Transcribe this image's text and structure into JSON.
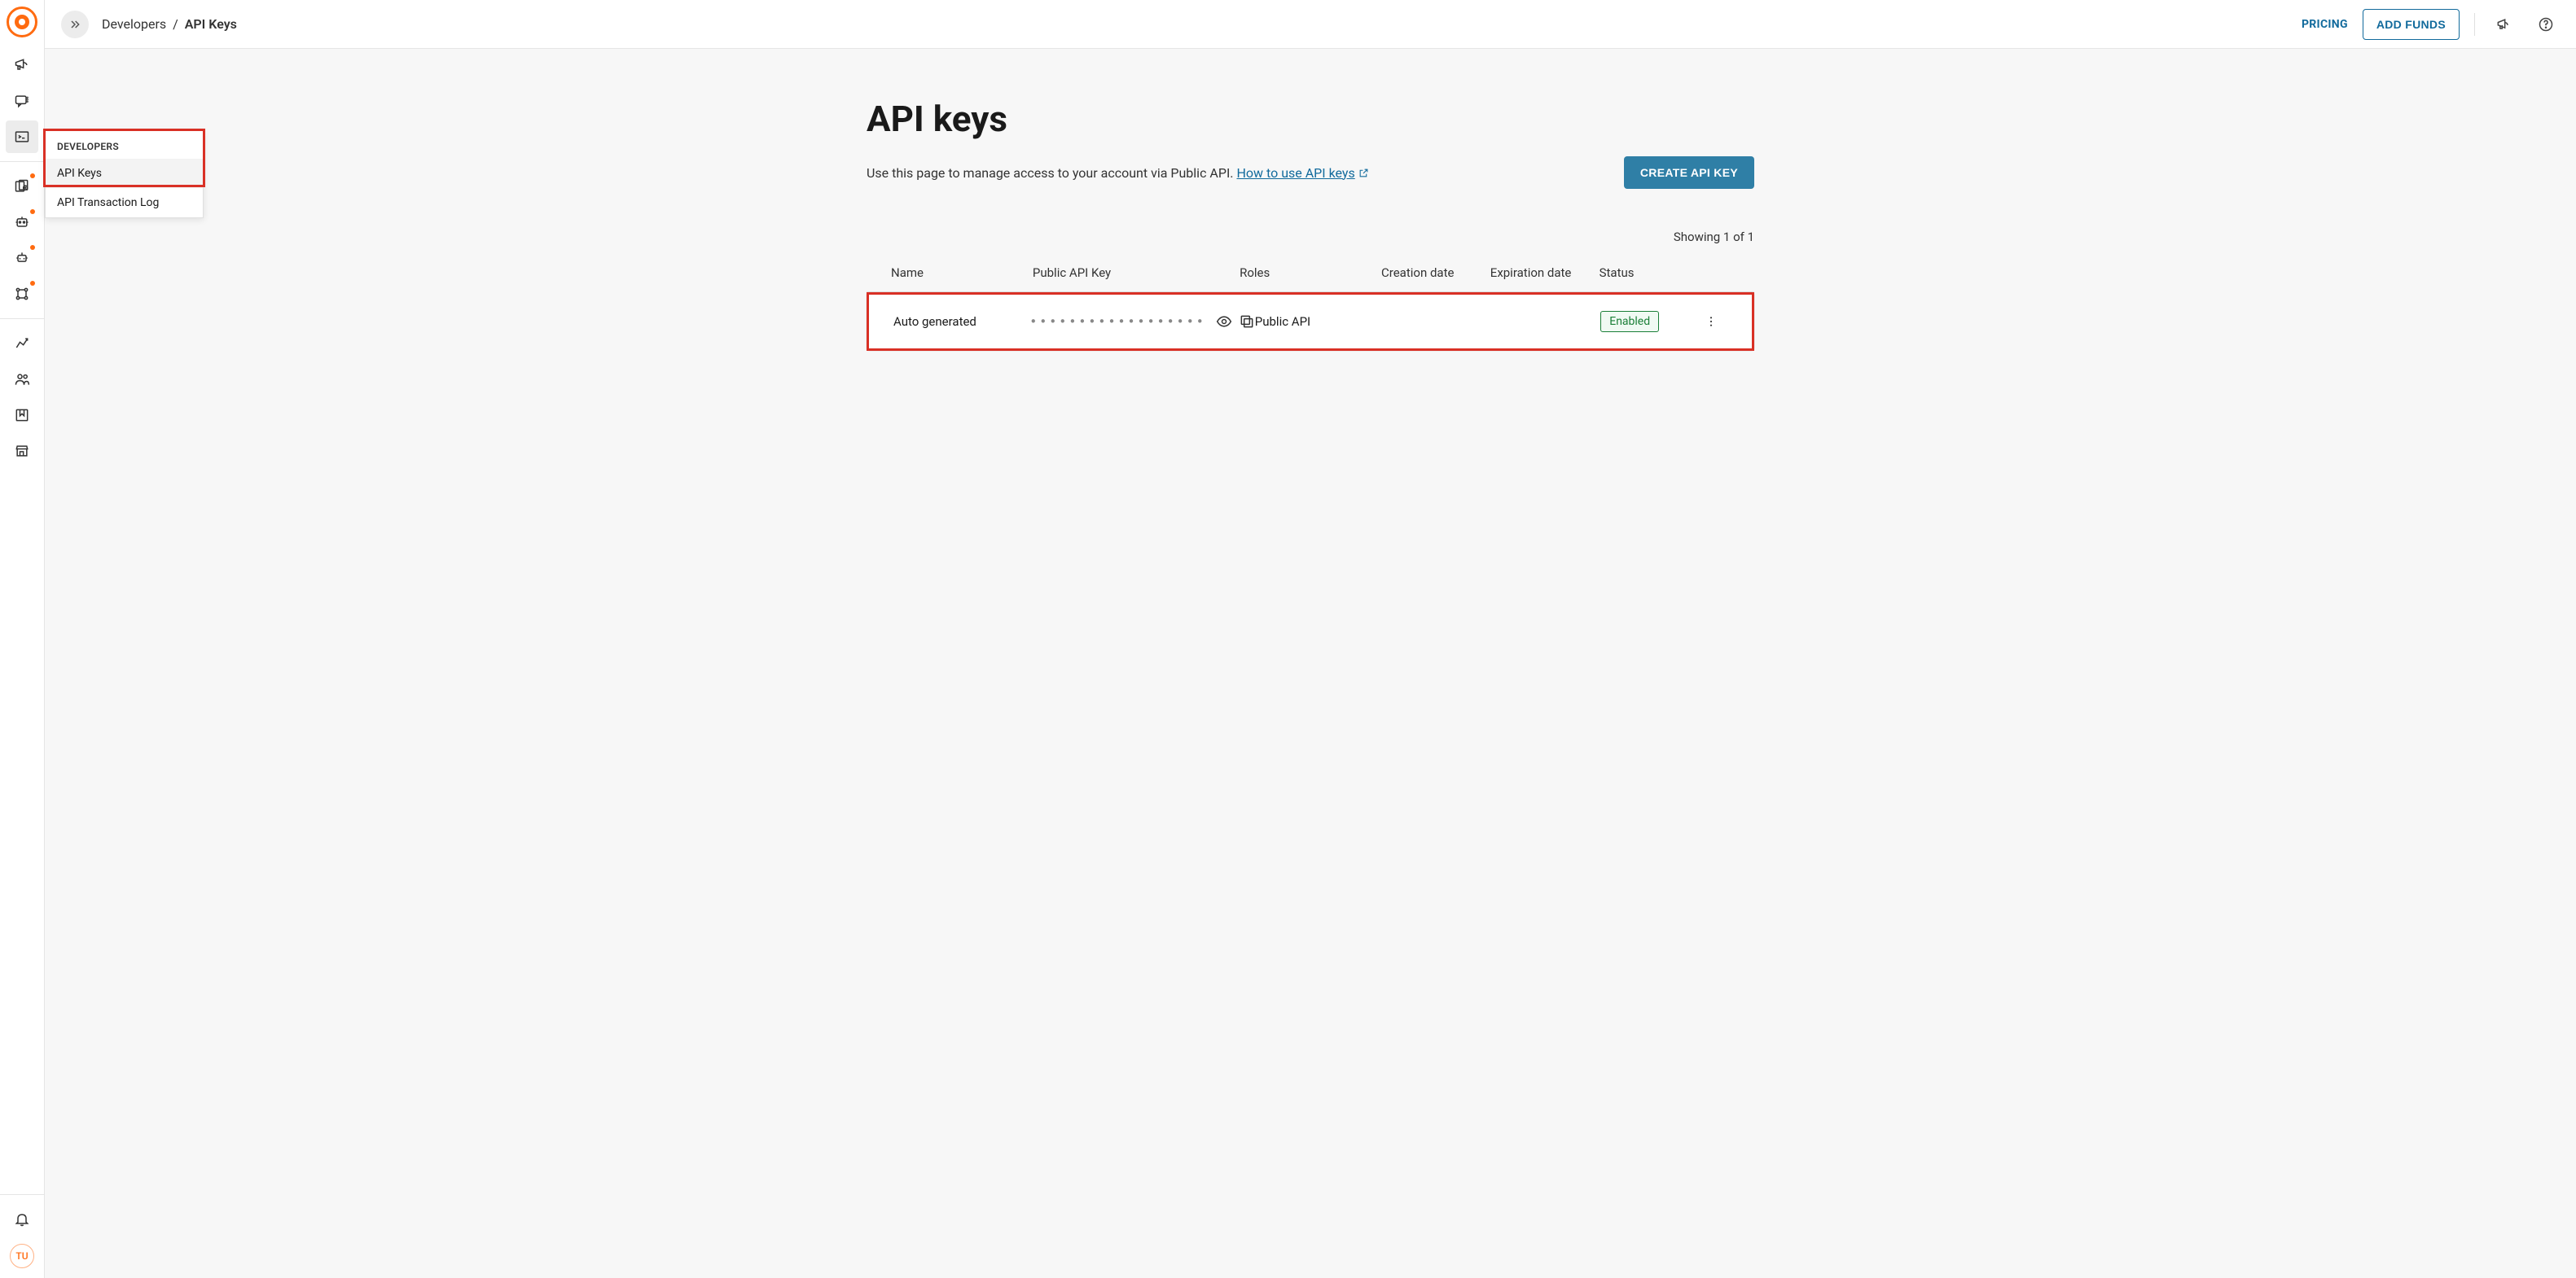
{
  "sidebar": {
    "user_initials": "TU"
  },
  "flyout": {
    "header": "DEVELOPERS",
    "items": [
      "API Keys",
      "API Transaction Log"
    ]
  },
  "breadcrumb": {
    "parent": "Developers",
    "sep": "/",
    "current": "API Keys"
  },
  "topbar": {
    "pricing": "PRICING",
    "add_funds": "ADD FUNDS"
  },
  "page": {
    "title": "API keys",
    "subtitle_prefix": "Use this page to manage access to your account via Public API. ",
    "subtitle_link": "How to use API keys",
    "create_btn": "CREATE API KEY",
    "showing": "Showing 1 of 1"
  },
  "table": {
    "headers": {
      "name": "Name",
      "key": "Public API Key",
      "roles": "Roles",
      "creation": "Creation date",
      "expiration": "Expiration date",
      "status": "Status"
    },
    "rows": [
      {
        "name": "Auto generated",
        "key_mask": "••••••••••••••••••",
        "roles": "Public API",
        "creation": "",
        "expiration": "",
        "status": "Enabled"
      }
    ]
  }
}
